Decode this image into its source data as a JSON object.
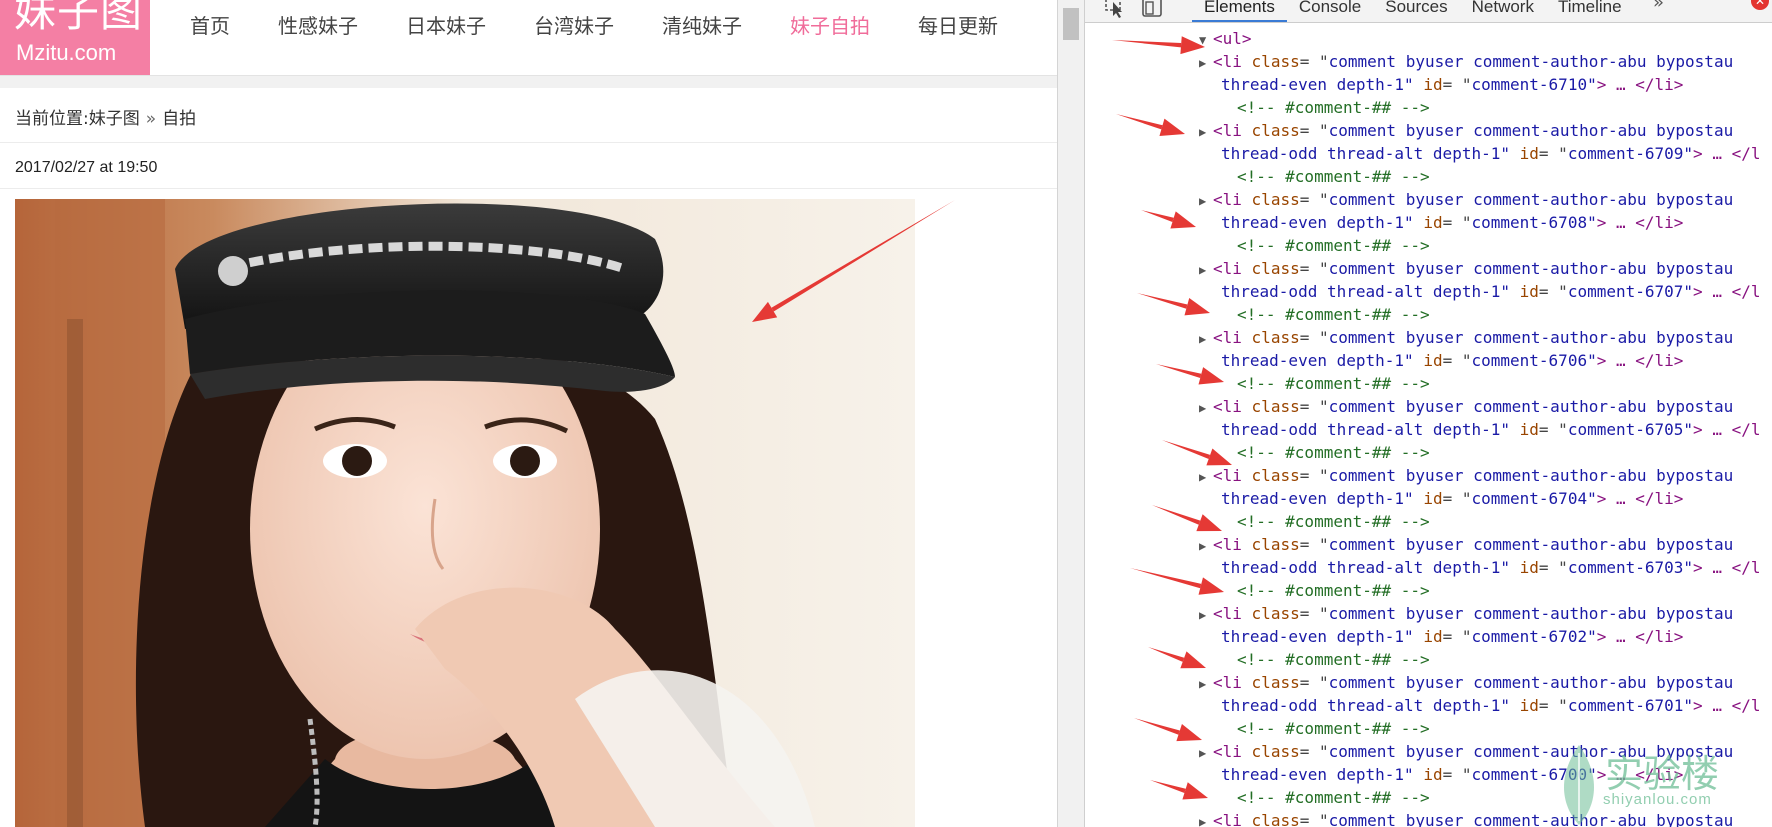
{
  "site": {
    "logo": {
      "cn": "妹子图",
      "en": "Mzitu.com"
    },
    "nav": [
      {
        "label": "首页",
        "active": false
      },
      {
        "label": "性感妹子",
        "active": false
      },
      {
        "label": "日本妹子",
        "active": false
      },
      {
        "label": "台湾妹子",
        "active": false
      },
      {
        "label": "清纯妹子",
        "active": false
      },
      {
        "label": "妹子自拍",
        "active": true
      },
      {
        "label": "每日更新",
        "active": false
      }
    ],
    "breadcrumb": {
      "prefix": "当前位置:",
      "home": "妹子图",
      "separator": "»",
      "current": "自拍"
    },
    "post_date": "2017/02/27 at 19:50",
    "photo": "selfie photo of a woman wearing a black leather cap with a chain",
    "accent_color": "#f47fa4"
  },
  "devtools": {
    "tabs": [
      {
        "label": "Elements",
        "active": true
      },
      {
        "label": "Console",
        "active": false
      },
      {
        "label": "Sources",
        "active": false
      },
      {
        "label": "Network",
        "active": false
      },
      {
        "label": "Timeline",
        "active": false
      }
    ],
    "more_icon": "»",
    "icons": [
      "inspect-cursor-icon",
      "device-toggle-icon",
      "close-error-icon"
    ],
    "root_tag": "<ul>",
    "comment_text": "<!-- #comment-## -->",
    "li_class_prefix": "comment byuser comment-author-abu bypostau",
    "items": [
      {
        "parity": "thread-even depth-1",
        "id": "comment-6710",
        "tail": "> … </li>"
      },
      {
        "parity": "thread-odd thread-alt depth-1",
        "id": "comment-6709",
        "tail": "> … </l"
      },
      {
        "parity": "thread-even depth-1",
        "id": "comment-6708",
        "tail": "> … </li>"
      },
      {
        "parity": "thread-odd thread-alt depth-1",
        "id": "comment-6707",
        "tail": "> … </l"
      },
      {
        "parity": "thread-even depth-1",
        "id": "comment-6706",
        "tail": "> … </li>"
      },
      {
        "parity": "thread-odd thread-alt depth-1",
        "id": "comment-6705",
        "tail": "> … </l"
      },
      {
        "parity": "thread-even depth-1",
        "id": "comment-6704",
        "tail": "> … </li>"
      },
      {
        "parity": "thread-odd thread-alt depth-1",
        "id": "comment-6703",
        "tail": "> … </l"
      },
      {
        "parity": "thread-even depth-1",
        "id": "comment-6702",
        "tail": "> … </li>"
      },
      {
        "parity": "thread-odd thread-alt depth-1",
        "id": "comment-6701",
        "tail": "> … </l"
      },
      {
        "parity": "thread-even depth-1",
        "id": "comment-6700",
        "tail": "> … </li>"
      }
    ]
  },
  "watermark": {
    "text": "实验楼",
    "url": "shiyanlou.com"
  },
  "annotation_color": "#e53935"
}
